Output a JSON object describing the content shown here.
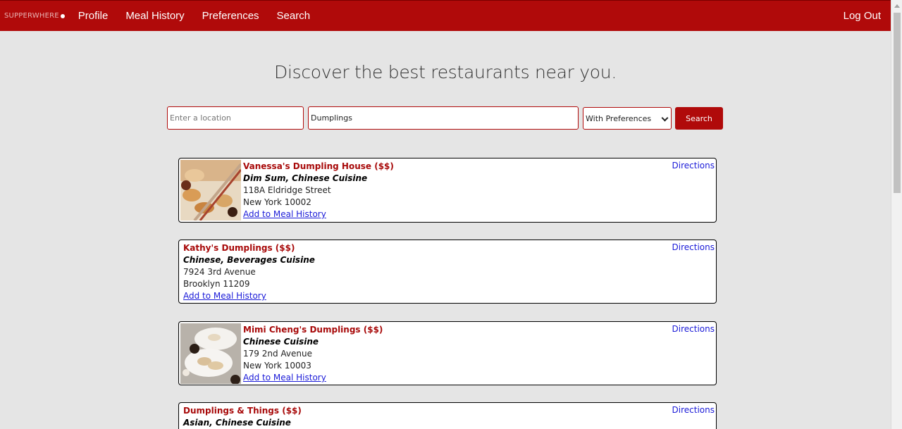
{
  "nav": {
    "brand": "SUPPERWHERE",
    "links": [
      "Profile",
      "Meal History",
      "Preferences",
      "Search"
    ],
    "logout": "Log Out"
  },
  "headline": "Discover the best restaurants near you.",
  "search": {
    "location_placeholder": "Enter a location",
    "query_value": "Dumplings",
    "filter_value": "With Preferences",
    "button_label": "Search"
  },
  "results": [
    {
      "name": "Vanessa's Dumpling House ($$)",
      "cuisine": "Dim Sum, Chinese Cuisine",
      "street": "118A Eldridge Street",
      "city": "New York 10002",
      "add_label": "Add to Meal History",
      "directions_label": "Directions",
      "has_image": true
    },
    {
      "name": "Kathy's Dumplings ($$)",
      "cuisine": "Chinese, Beverages Cuisine",
      "street": "7924 3rd Avenue",
      "city": "Brooklyn 11209",
      "add_label": "Add to Meal History",
      "directions_label": "Directions",
      "has_image": false
    },
    {
      "name": "Mimi Cheng's Dumplings ($$)",
      "cuisine": "Chinese Cuisine",
      "street": "179 2nd Avenue",
      "city": "New York 10003",
      "add_label": "Add to Meal History",
      "directions_label": "Directions",
      "has_image": true
    },
    {
      "name": "Dumplings & Things ($$)",
      "cuisine": "Asian, Chinese Cuisine",
      "directions_label": "Directions",
      "has_image": false
    }
  ],
  "colors": {
    "brand_red": "#b00a0a",
    "page_bg": "#e5e5e5",
    "link_blue": "#1a1ad8"
  }
}
